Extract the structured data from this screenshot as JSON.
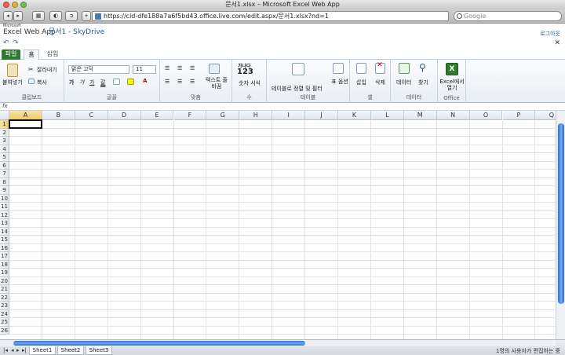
{
  "window": {
    "title": "문서1.xlsx – Microsoft Excel Web App"
  },
  "browser": {
    "back": "◂",
    "forward": "▸",
    "url": "https://cid-dfe188a7a6f5bd43.office.live.com/edit.aspx/문서1.xlsx?nd=1",
    "search_placeholder": "Google"
  },
  "brand": {
    "ms": "Microsoft",
    "app": "Excel Web App",
    "doc": "문서1 - SkyDrive",
    "login": "로그아웃"
  },
  "quick": {
    "undo": "↶",
    "redo": "↷",
    "close": "✕"
  },
  "tabs": [
    "파일",
    "홈",
    "삽입"
  ],
  "ribbon": {
    "clipboard": {
      "label": "클립보드",
      "paste": "붙여넣기",
      "cut": "잘라내기",
      "copy": "복사"
    },
    "font": {
      "label": "글꼴",
      "face": "맑은 고딕",
      "size": "11",
      "bold": "가",
      "italic": "가",
      "underline": "가",
      "double": "갈"
    },
    "align": {
      "label": "맞춤",
      "wrap": "텍스트 줄 바꿈"
    },
    "number": {
      "label": "수",
      "sample": "가나다",
      "digits": "123",
      "format": "숫자 서식"
    },
    "table": {
      "label": "테이블",
      "sortfilter": "테이블로 정렬 및 필터",
      "options": "표 옵션"
    },
    "cells": {
      "label": "셀",
      "insert": "삽입",
      "delete": "삭제"
    },
    "data": {
      "label": "데이터",
      "data": "데이터",
      "find": "찾기"
    },
    "office": {
      "label": "Office",
      "open": "Excel에서 열기"
    }
  },
  "formula": {
    "fx": "fx",
    "value": ""
  },
  "grid": {
    "columns": [
      "A",
      "B",
      "C",
      "D",
      "E",
      "F",
      "G",
      "H",
      "I",
      "J",
      "K",
      "L",
      "M",
      "N",
      "O",
      "P",
      "Q"
    ],
    "rows": [
      "1",
      "2",
      "3",
      "4",
      "5",
      "6",
      "7",
      "8",
      "9",
      "10",
      "11",
      "12",
      "13",
      "14",
      "15",
      "16",
      "17",
      "18",
      "19",
      "20",
      "21",
      "22",
      "23",
      "24",
      "25",
      "26"
    ],
    "active_cell": "A1"
  },
  "sheets": [
    "Sheet1",
    "Sheet2",
    "Sheet3"
  ],
  "status": "1명의 사용자가 편집하는 중"
}
